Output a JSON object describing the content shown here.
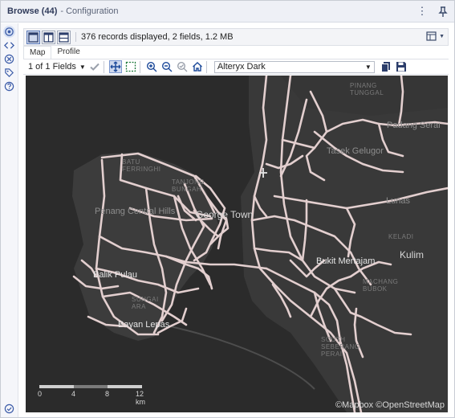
{
  "titlebar": {
    "title": "Browse (44)",
    "subtitle": "- Configuration",
    "more_icon": "more-vertical-icon",
    "pin_icon": "pin-icon"
  },
  "leftbar": {
    "items": [
      "settings-icon",
      "code-icon",
      "x-circle-icon",
      "tag-icon",
      "help-icon"
    ],
    "bottom": "check-circle-icon"
  },
  "toolbar": {
    "records_text": "376 records displayed, 2 fields, 1.2 MB"
  },
  "tabs": [
    {
      "label": "Map",
      "active": true
    },
    {
      "label": "Profile",
      "active": false
    }
  ],
  "map_toolbar": {
    "fields_selector": "1 of 1 Fields",
    "basemap": "Alteryx Dark"
  },
  "map": {
    "labels": {
      "pinang_tunggal": "PINANG\nTUNGGAL",
      "padang_serai": "Padang Serai",
      "tasek_gelugor": "Tasek Gelugor",
      "batu_ferringhi": "BATU\nFERRINGHI",
      "tanjong_bungah": "TANJONG\nBUNGAH",
      "penang_central_hills": "Penang Central Hills",
      "george_town": "George Town",
      "lunas": "Lunas",
      "keladi": "KELADI",
      "kulim": "Kulim",
      "bukit_mertajam": "Bukit Mertajam",
      "balik_pulau": "Balik Pulau",
      "sungai_ara": "SUNGAI\nARA",
      "bayan_lepas": "Bayan Lepas",
      "machang_bubok": "MACHANG\nBUBOK",
      "south_seberang_perai": "SOUTH\nSEBERANG\nPERAI"
    },
    "attribution": "©Mapbox ©OpenStreetMap",
    "scale_ticks": [
      "0",
      "4",
      "8",
      "12 km"
    ],
    "colors": {
      "water": "#2b2b2b",
      "land": "#3a3a3a",
      "route": "#e3cfcf"
    }
  }
}
